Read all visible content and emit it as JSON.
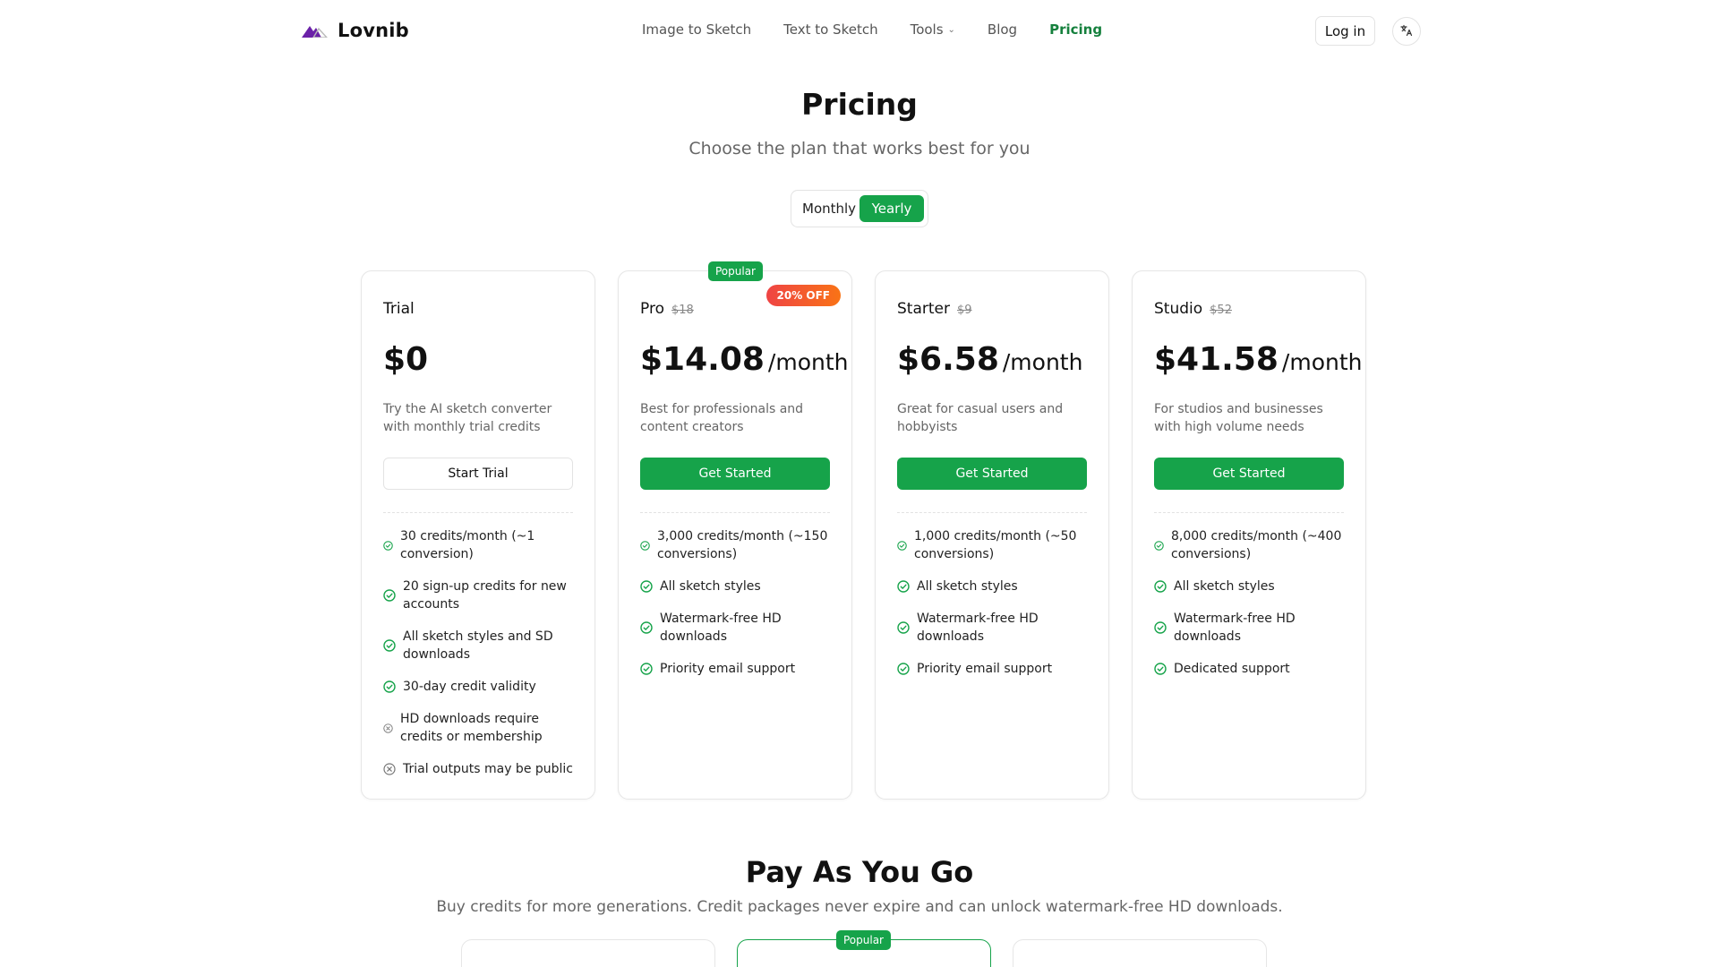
{
  "brand": {
    "name": "Lovnib",
    "logo_icon": "mountain-logo-icon"
  },
  "nav": {
    "items": [
      {
        "label": "Image to Sketch"
      },
      {
        "label": "Text to Sketch"
      },
      {
        "label": "Tools",
        "has_dropdown": true
      },
      {
        "label": "Blog"
      },
      {
        "label": "Pricing",
        "active": true
      }
    ],
    "login_label": "Log in",
    "lang_icon": "translate-icon"
  },
  "hero": {
    "title": "Pricing",
    "subtitle": "Choose the plan that works best for you"
  },
  "billing_toggle": {
    "monthly_label": "Monthly",
    "yearly_label": "Yearly",
    "selected": "Yearly"
  },
  "plans": [
    {
      "name": "Trial",
      "old_price": "",
      "price": "$0",
      "unit": "",
      "description": "Try the AI sketch converter with monthly trial credits",
      "cta": "Start Trial",
      "features": [
        {
          "text": "30 credits/month (~1 conversion)",
          "icon": "check-circle-icon"
        },
        {
          "text": "20 sign-up credits for new accounts",
          "icon": "check-circle-icon"
        },
        {
          "text": "All sketch styles and SD downloads",
          "icon": "check-circle-icon"
        },
        {
          "text": "30-day credit validity",
          "icon": "check-circle-icon"
        },
        {
          "text": "HD downloads require credits or membership",
          "icon": "x-circle-icon"
        },
        {
          "text": "Trial outputs may be public",
          "icon": "x-circle-icon"
        }
      ]
    },
    {
      "name": "Pro",
      "old_price": "$18",
      "price": "$14.08",
      "unit": "/month",
      "description": "Best for professionals and content creators",
      "cta": "Get Started",
      "badge": "Popular",
      "discount": "20% OFF",
      "features": [
        {
          "text": "3,000 credits/month (~150 conversions)",
          "icon": "check-circle-icon"
        },
        {
          "text": "All sketch styles",
          "icon": "check-circle-icon"
        },
        {
          "text": "Watermark-free HD downloads",
          "icon": "check-circle-icon"
        },
        {
          "text": "Priority email support",
          "icon": "check-circle-icon"
        }
      ]
    },
    {
      "name": "Starter",
      "old_price": "$9",
      "price": "$6.58",
      "unit": "/month",
      "description": "Great for casual users and hobbyists",
      "cta": "Get Started",
      "features": [
        {
          "text": "1,000 credits/month (~50 conversions)",
          "icon": "check-circle-icon"
        },
        {
          "text": "All sketch styles",
          "icon": "check-circle-icon"
        },
        {
          "text": "Watermark-free HD downloads",
          "icon": "check-circle-icon"
        },
        {
          "text": "Priority email support",
          "icon": "check-circle-icon"
        }
      ]
    },
    {
      "name": "Studio",
      "old_price": "$52",
      "price": "$41.58",
      "unit": "/month",
      "description": "For studios and businesses with high volume needs",
      "cta": "Get Started",
      "features": [
        {
          "text": "8,000 credits/month (~400 conversions)",
          "icon": "check-circle-icon"
        },
        {
          "text": "All sketch styles",
          "icon": "check-circle-icon"
        },
        {
          "text": "Watermark-free HD downloads",
          "icon": "check-circle-icon"
        },
        {
          "text": "Dedicated support",
          "icon": "check-circle-icon"
        }
      ]
    }
  ],
  "payg": {
    "title": "Pay As You Go",
    "subtitle": "Buy credits for more generations. Credit packages never expire and can unlock watermark-free HD downloads.",
    "popular_badge": "Popular"
  },
  "colors": {
    "accent": "#16a34a",
    "active_nav": "#15803d",
    "discount_from": "#ef4444",
    "discount_to": "#f97316"
  }
}
